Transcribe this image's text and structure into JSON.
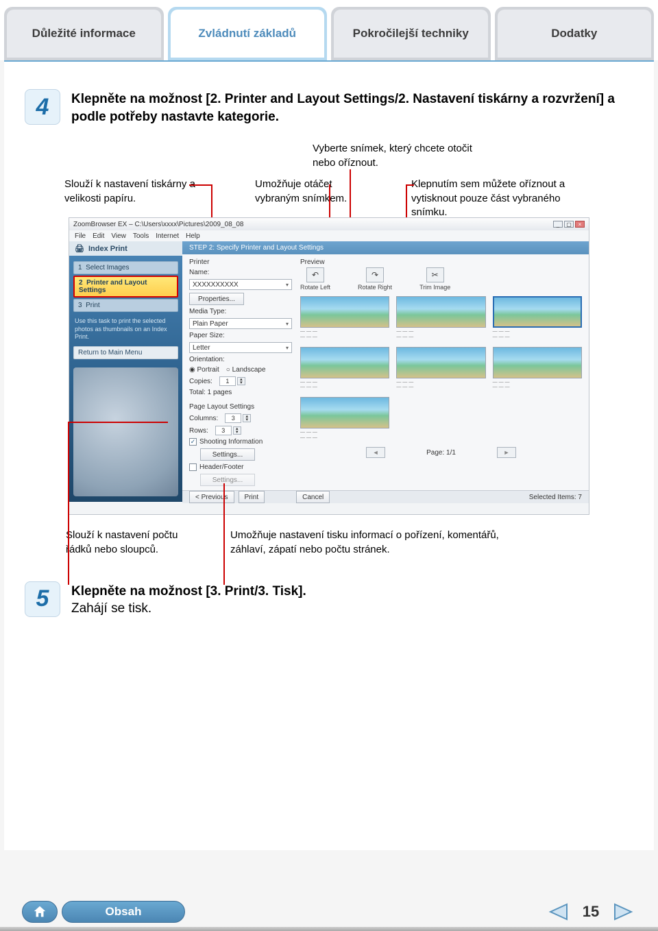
{
  "tabs": [
    {
      "label": "Důležité informace"
    },
    {
      "label": "Zvládnutí základů"
    },
    {
      "label": "Pokročilejší techniky"
    },
    {
      "label": "Dodatky"
    }
  ],
  "active_tab_index": 1,
  "step4": {
    "num": "4",
    "bold": "Klepněte na možnost [2. Printer and Layout Settings/2. Nastavení tiskárny a rozvržení] a podle potřeby nastavte kategorie."
  },
  "callouts": {
    "top_center": "Vyberte snímek, který chcete otočit nebo oříznout.",
    "left": "Slouží k nastavení tiskárny a velikosti papíru.",
    "mid": "Umožňuje otáčet vybraným snímkem.",
    "right": "Klepnutím sem můžete oříznout a vytisknout pouze část vybraného snímku.",
    "bottom_left": "Slouží k nastavení počtu řádků nebo sloupců.",
    "bottom_right": "Umožňuje nastavení tisku informací o pořízení, komentářů, záhlaví, zápatí nebo počtu stránek."
  },
  "screenshot": {
    "title": "ZoomBrowser EX – C:\\Users\\xxxx\\Pictures\\2009_08_08",
    "menu": [
      "File",
      "Edit",
      "View",
      "Tools",
      "Internet",
      "Help"
    ],
    "left": {
      "header": "Index Print",
      "steps": [
        {
          "n": "1",
          "label": "Select Images"
        },
        {
          "n": "2",
          "label": "Printer and Layout Settings"
        },
        {
          "n": "3",
          "label": "Print"
        }
      ],
      "hint": "Use this task to print the selected photos as thumbnails on an Index Print.",
      "return": "Return to Main Menu"
    },
    "right_head": "STEP 2: Specify Printer and Layout Settings",
    "printer": {
      "section": "Printer",
      "name_label": "Name:",
      "name_value": "XXXXXXXXXX",
      "properties": "Properties...",
      "media_label": "Media Type:",
      "media_value": "Plain Paper",
      "size_label": "Paper Size:",
      "size_value": "Letter",
      "orient_label": "Orientation:",
      "portrait": "Portrait",
      "landscape": "Landscape",
      "copies_label": "Copies:",
      "copies_value": "1",
      "total": "Total: 1 pages"
    },
    "layout": {
      "section": "Page Layout Settings",
      "columns_label": "Columns:",
      "columns_value": "3",
      "rows_label": "Rows:",
      "rows_value": "3",
      "shooting_chk": "Shooting Information",
      "settings_btn": "Settings...",
      "header_chk": "Header/Footer"
    },
    "preview": {
      "label": "Preview",
      "toolbar": [
        {
          "icon": "↶",
          "label": "Rotate Left"
        },
        {
          "icon": "↷",
          "label": "Rotate Right"
        },
        {
          "icon": "✂",
          "label": "Trim Image"
        }
      ],
      "page": "Page: 1/1"
    },
    "footer": {
      "previous": "< Previous",
      "print": "Print",
      "cancel": "Cancel",
      "status": "Selected Items: 7"
    }
  },
  "step5": {
    "num": "5",
    "bold": "Klepněte na možnost [3. Print/3. Tisk].",
    "plain": "Zahájí se tisk."
  },
  "bottom": {
    "obsah": "Obsah",
    "page": "15"
  }
}
